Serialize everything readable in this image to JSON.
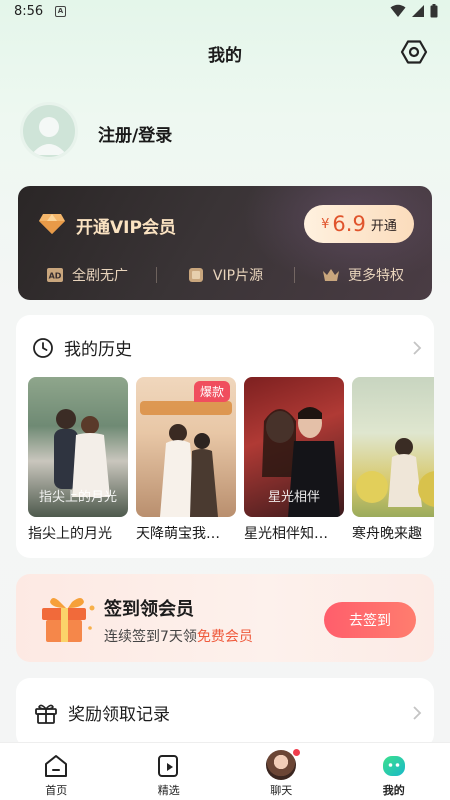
{
  "status_bar": {
    "time": "8:56",
    "notification_letter": "A"
  },
  "header": {
    "title": "我的"
  },
  "profile": {
    "login_label": "注册/登录"
  },
  "vip": {
    "title": "开通VIP会员",
    "price_symbol": "¥",
    "price": "6.9",
    "button_label": "开通",
    "perks": [
      {
        "label": "全剧无广",
        "icon": "ad-free-icon"
      },
      {
        "label": "VIP片源",
        "icon": "vip-source-icon"
      },
      {
        "label": "更多特权",
        "icon": "crown-icon"
      }
    ],
    "accent_color": "#fbe3c2"
  },
  "history": {
    "title": "我的历史",
    "items": [
      {
        "name": "指尖上的月光",
        "poster_caption": "指尖上的月光",
        "badge": ""
      },
      {
        "name": "天降萌宝我…",
        "poster_caption": "",
        "badge": "爆款"
      },
      {
        "name": "星光相伴知…",
        "poster_caption": "星光相伴",
        "badge": ""
      },
      {
        "name": "寒舟晚来趣",
        "poster_caption": "",
        "badge": ""
      }
    ]
  },
  "signin": {
    "title": "签到领会员",
    "subtitle_prefix": "连续签到7天领",
    "subtitle_highlight": "免费会员",
    "button_label": "去签到",
    "highlight_color": "#ef5a3c"
  },
  "rewards": {
    "title": "奖励领取记录"
  },
  "tabs": [
    {
      "label": "首页",
      "icon": "home-icon",
      "active": false
    },
    {
      "label": "精选",
      "icon": "play-square-icon",
      "active": false
    },
    {
      "label": "聊天",
      "icon": "chat-avatar-icon",
      "active": false
    },
    {
      "label": "我的",
      "icon": "me-icon",
      "active": true
    }
  ]
}
